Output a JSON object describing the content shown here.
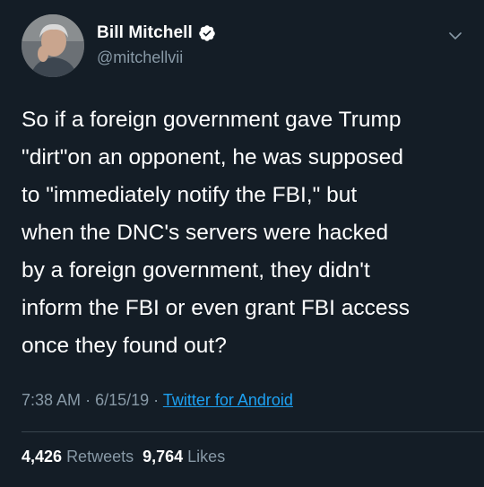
{
  "author": {
    "name": "Bill Mitchell",
    "handle": "@mitchellvii",
    "verified": true
  },
  "tweet": {
    "text": "So if a foreign government gave Trump\n\"dirt\"on an opponent, he was supposed\nto \"immediately notify the FBI,\" but\nwhen the DNC's servers were hacked\nby a foreign government, they didn't\ninform the FBI or even grant FBI access\nonce they found out?",
    "time": "7:38 AM",
    "separator1": "·",
    "date": "6/15/19",
    "separator2": "·",
    "source": "Twitter for Android"
  },
  "stats": {
    "retweets_count": "4,426",
    "retweets_label": "Retweets",
    "likes_count": "9,764",
    "likes_label": "Likes"
  },
  "icons": {
    "verified": "verified-badge-icon",
    "menu": "chevron-down-icon"
  },
  "colors": {
    "background": "#141d26",
    "text": "#ffffff",
    "secondary_text": "#8899a6",
    "link": "#1da1f2"
  }
}
